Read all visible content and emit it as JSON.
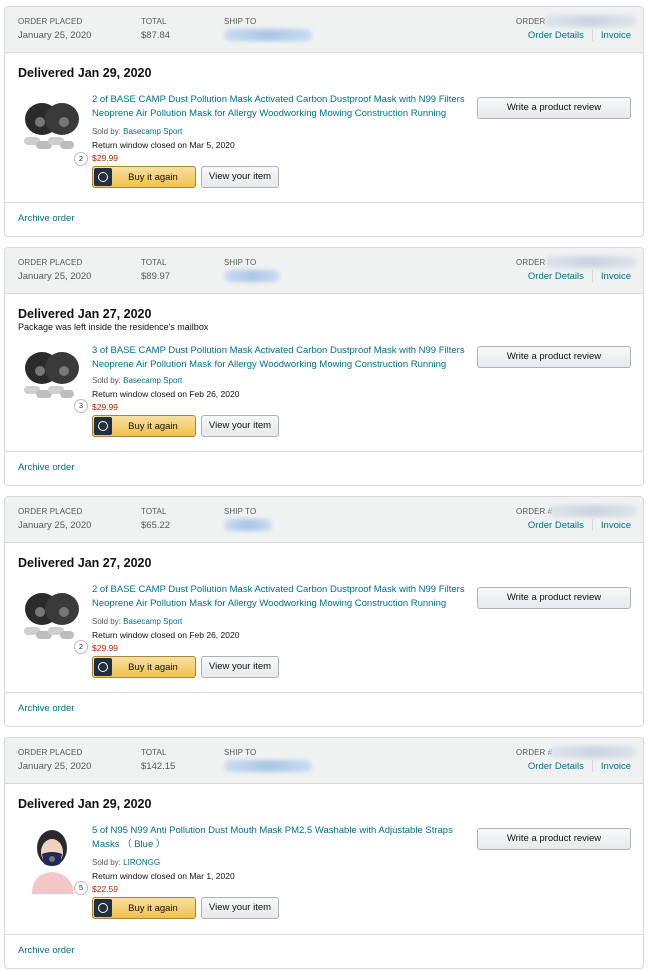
{
  "header_labels": {
    "order_placed": "ORDER PLACED",
    "total": "TOTAL",
    "ship_to": "SHIP TO",
    "order_num": "ORDER #",
    "order_details": "Order Details",
    "invoice": "Invoice"
  },
  "actions": {
    "buy_again": "Buy it again",
    "view_item": "View your item",
    "write_review": "Write a product review",
    "archive": "Archive order",
    "sold_by_prefix": "Sold by:"
  },
  "colors": {
    "link": "#007185",
    "price": "#B12704",
    "buy_button": "#f0c14b"
  },
  "icons": {
    "buy_again": "reorder-icon"
  },
  "orders": [
    {
      "placed": "January 25, 2020",
      "total": "$87.84",
      "status": "Delivered Jan 29, 2020",
      "note": "",
      "qty": "2",
      "title": "2 of BASE CAMP Dust Pollution Mask Activated Carbon Dustproof Mask with N99 Filters Neoprene Air Pollution Mask for Allergy Woodworking Mowing Construction Running",
      "seller": "Basecamp Sport",
      "return_window": "Return window closed on Mar 5, 2020",
      "price": "$29.99"
    },
    {
      "placed": "January 25, 2020",
      "total": "$89.97",
      "status": "Delivered Jan 27, 2020",
      "note": "Package was left inside the residence's mailbox",
      "qty": "3",
      "title": "3 of BASE CAMP Dust Pollution Mask Activated Carbon Dustproof Mask with N99 Filters Neoprene Air Pollution Mask for Allergy Woodworking Mowing Construction Running",
      "seller": "Basecamp Sport",
      "return_window": "Return window closed on Feb 26, 2020",
      "price": "$29.99"
    },
    {
      "placed": "January 25, 2020",
      "total": "$65.22",
      "status": "Delivered Jan 27, 2020",
      "note": "",
      "qty": "2",
      "title": "2 of BASE CAMP Dust Pollution Mask Activated Carbon Dustproof Mask with N99 Filters Neoprene Air Pollution Mask for Allergy Woodworking Mowing Construction Running",
      "seller": "Basecamp Sport",
      "return_window": "Return window closed on Feb 26, 2020",
      "price": "$29.99"
    },
    {
      "placed": "January 25, 2020",
      "total": "$142.15",
      "status": "Delivered Jan 29, 2020",
      "note": "",
      "qty": "5",
      "title": "5 of N95 N99 Anti Pollution Dust Mouth Mask PM2.5 Washable with Adjustable Straps Masks （ Blue ）",
      "seller": "LIRONGG",
      "return_window": "Return window closed on Mar 1, 2020",
      "price": "$22.59"
    }
  ]
}
